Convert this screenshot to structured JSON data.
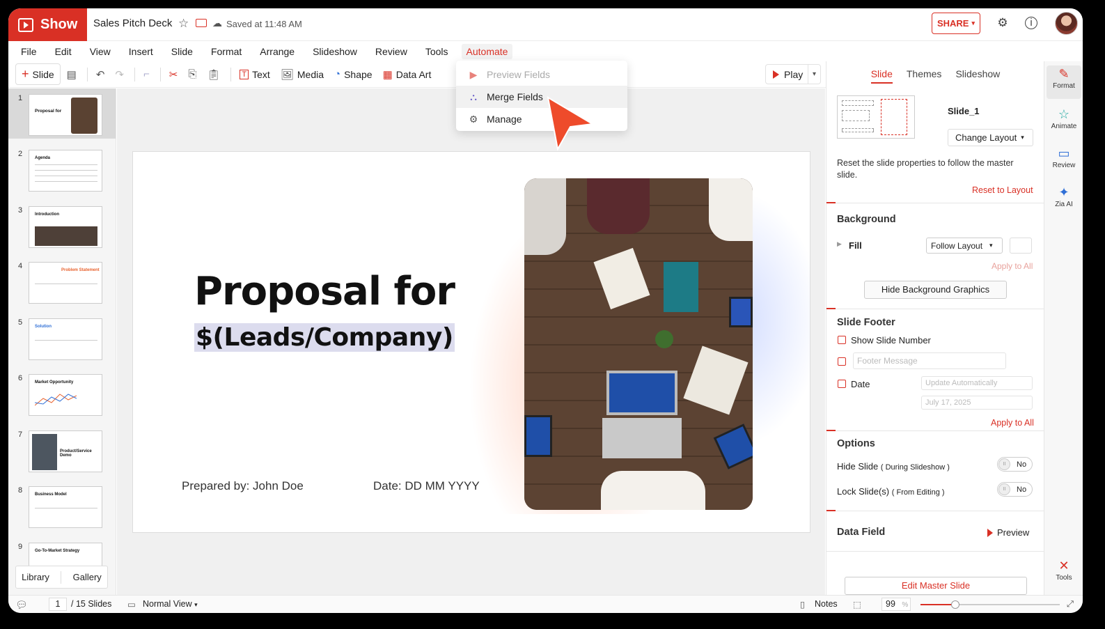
{
  "app": {
    "brand": "Show",
    "doc_title": "Sales Pitch Deck",
    "saved_status": "Saved at 11:48 AM",
    "share_label": "SHARE"
  },
  "menu": [
    "File",
    "Edit",
    "View",
    "Insert",
    "Slide",
    "Format",
    "Arrange",
    "Slideshow",
    "Review",
    "Tools",
    "Automate"
  ],
  "toolbar": {
    "slide": "Slide",
    "text": "Text",
    "media": "Media",
    "shape": "Shape",
    "data_art": "Data Art",
    "play": "Play"
  },
  "automate_menu": {
    "preview_fields": "Preview Fields",
    "merge_fields": "Merge Fields",
    "manage": "Manage"
  },
  "thumbnails": [
    {
      "num": "1",
      "title": "Proposal for"
    },
    {
      "num": "2",
      "title": "Agenda"
    },
    {
      "num": "3",
      "title": "Introduction"
    },
    {
      "num": "4",
      "title": "Problem Statement"
    },
    {
      "num": "5",
      "title": "Solution"
    },
    {
      "num": "6",
      "title": "Market Opportunity"
    },
    {
      "num": "7",
      "title": "Product/Service Demo"
    },
    {
      "num": "8",
      "title": "Business Model"
    },
    {
      "num": "9",
      "title": "Go-To-Market Strategy"
    }
  ],
  "library": {
    "library": "Library",
    "gallery": "Gallery"
  },
  "slide": {
    "title": "Proposal for",
    "merge_field": "$(Leads/Company)",
    "prepared_by": "Prepared by: John Doe",
    "date": "Date: DD MM YYYY"
  },
  "panel": {
    "tabs": [
      "Slide",
      "Themes",
      "Slideshow"
    ],
    "slide_name": "Slide_1",
    "change_layout": "Change Layout",
    "reset_text": "Reset the slide properties to follow the master slide.",
    "reset_link": "Reset to Layout",
    "background_title": "Background",
    "fill_label": "Fill",
    "fill_value": "Follow Layout",
    "apply_all": "Apply to All",
    "hide_bg": "Hide Background Graphics",
    "footer_title": "Slide Footer",
    "show_slide_number": "Show Slide Number",
    "footer_placeholder": "Footer Message",
    "date_label": "Date",
    "date_option": "Update Automatically",
    "date_value": "July 17, 2025",
    "apply_all_footer": "Apply to All",
    "options_title": "Options",
    "hide_slide": "Hide Slide",
    "hide_slide_note": "( During Slideshow )",
    "lock_slide": "Lock Slide(s)",
    "lock_slide_note": "( From Editing )",
    "toggle_no": "No",
    "data_field_title": "Data Field",
    "preview": "Preview",
    "edit_master": "Edit Master Slide"
  },
  "rail": [
    "Format",
    "Animate",
    "Review",
    "Zia AI",
    "Tools"
  ],
  "status": {
    "page": "1",
    "total": "/ 15 Slides",
    "view": "Normal View",
    "notes": "Notes",
    "zoom": "99",
    "zoom_unit": "%",
    "zoom_level": 0.25
  },
  "colors": {
    "brand": "#d93025"
  }
}
